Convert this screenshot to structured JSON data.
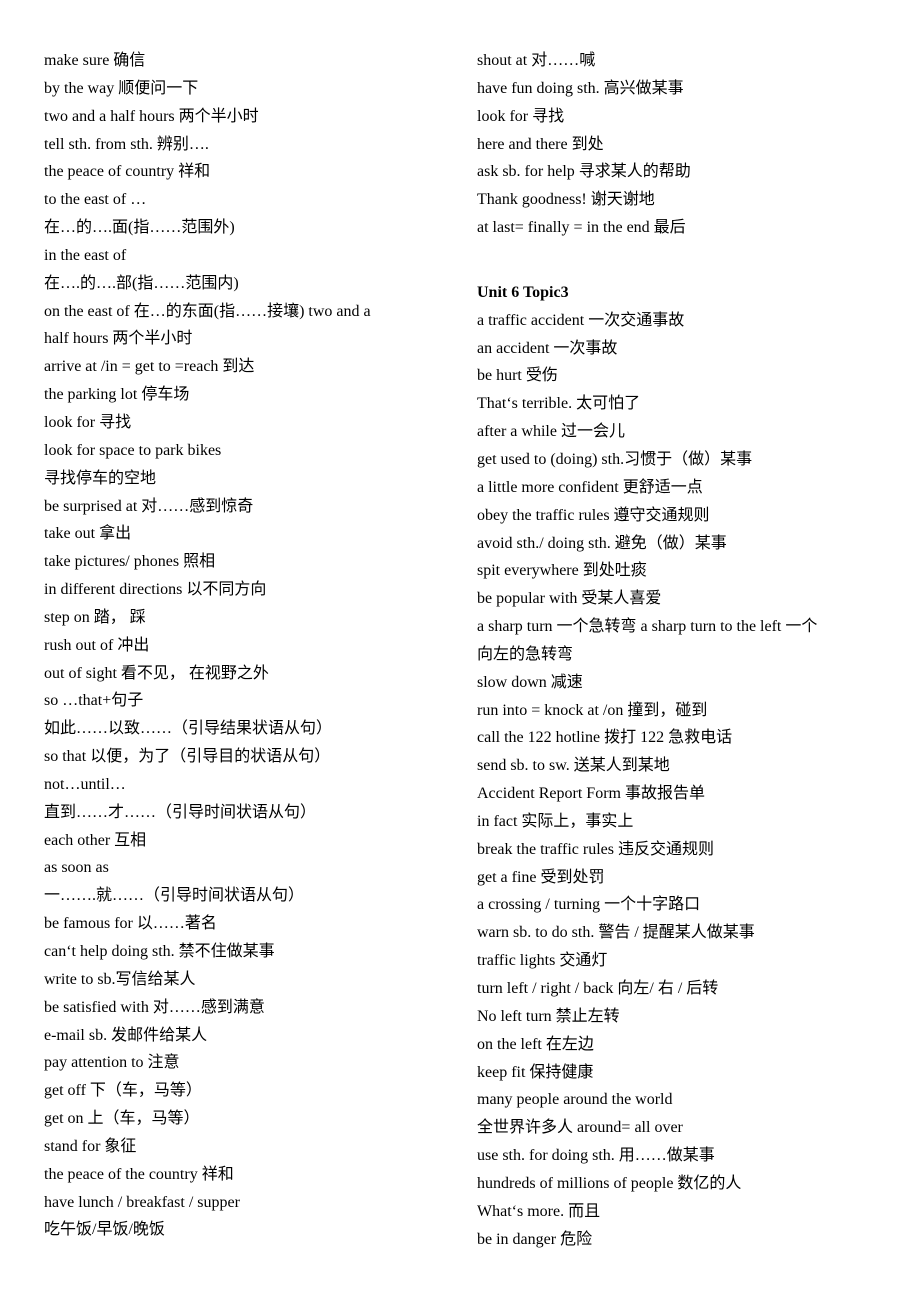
{
  "left_column": [
    "make sure 确信",
    "by the way 顺便问一下",
    "two and a half hours 两个半小时",
    "tell sth. from sth.  辨别….",
    "the peace of country 祥和",
    "to the east of …",
    "在…的….面(指……范围外)",
    "in the east of",
    "在….的….部(指……范围内)",
    "on the east of    在…的东面(指……接壤)    two and a",
    "half hours    两个半小时",
    "arrive at /in = get to =reach 到达",
    "the parking lot 停车场",
    "look for 寻找",
    "look for space to park bikes",
    "寻找停车的空地",
    "be surprised at 对……感到惊奇",
    "take out 拿出",
    "take pictures/ phones 照相",
    "in different directions 以不同方向",
    "step on 踏，   踩",
    "rush out of    冲出",
    "out of sight 看不见，   在视野之外",
    "so  …that+句子",
    "如此……以致……（引导结果状语从句）",
    "so that 以便，为了（引导目的状语从句）",
    "not…until…",
    "直到……才……（引导时间状语从句）",
    "each other 互相",
    "as soon as",
    "一…….就……（引导时间状语从句）",
    "be famous for 以……著名",
    "can‘t help doing sth.  禁不住做某事",
    "write to sb.写信给某人",
    "be satisfied with 对……感到满意",
    "e-mail sb.  发邮件给某人",
    "pay attention to 注意",
    "get off 下（车，马等）",
    "get on 上（车，马等）",
    "stand for 象征",
    "the peace of the country 祥和",
    "have lunch / breakfast / supper",
    "吃午饭/早饭/晚饭"
  ],
  "right_column_top": [
    "shout at 对……喊",
    "have fun doing sth.  高兴做某事",
    "look for 寻找",
    "here and there 到处",
    "ask sb. for help 寻求某人的帮助",
    "Thank goodness!  谢天谢地",
    "at last= finally = in the end 最后"
  ],
  "section_heading": "Unit 6 Topic3",
  "right_column_section": [
    "a traffic accident 一次交通事故",
    "an accident 一次事故",
    "be hurt 受伤",
    "That‘s terrible.  太可怕了",
    "after a while 过一会儿",
    "get used to (doing) sth.习惯于（做）某事",
    "a little more confident    更舒适一点",
    "obey the traffic rules 遵守交通规则",
    "avoid sth./ doing sth.  避免（做）某事",
    "spit everywhere 到处吐痰",
    "be popular with 受某人喜爱",
    "a sharp turn 一个急转弯    a sharp turn to the left 一个",
    "向左的急转弯",
    "slow down 减速",
    "run into = knock at /on 撞到，碰到",
    "call the 122 hotline 拨打 122 急救电话",
    "send sb. to sw.  送某人到某地",
    "Accident Report Form 事故报告单",
    "in fact 实际上，事实上",
    "break the traffic rules 违反交通规则",
    "get a fine 受到处罚",
    "a crossing / turning 一个十字路口",
    "warn sb. to do sth.  警告 / 提醒某人做某事",
    "traffic lights 交通灯",
    "turn left / right / back 向左/  右  /  后转",
    "No left turn 禁止左转",
    "on the left 在左边",
    "keep fit 保持健康",
    "many people around the world",
    "全世界许多人 around= all over",
    "use sth. for doing sth.  用……做某事",
    "hundreds of millions of people 数亿的人",
    "What‘s more.  而且",
    "be in danger    危险"
  ]
}
